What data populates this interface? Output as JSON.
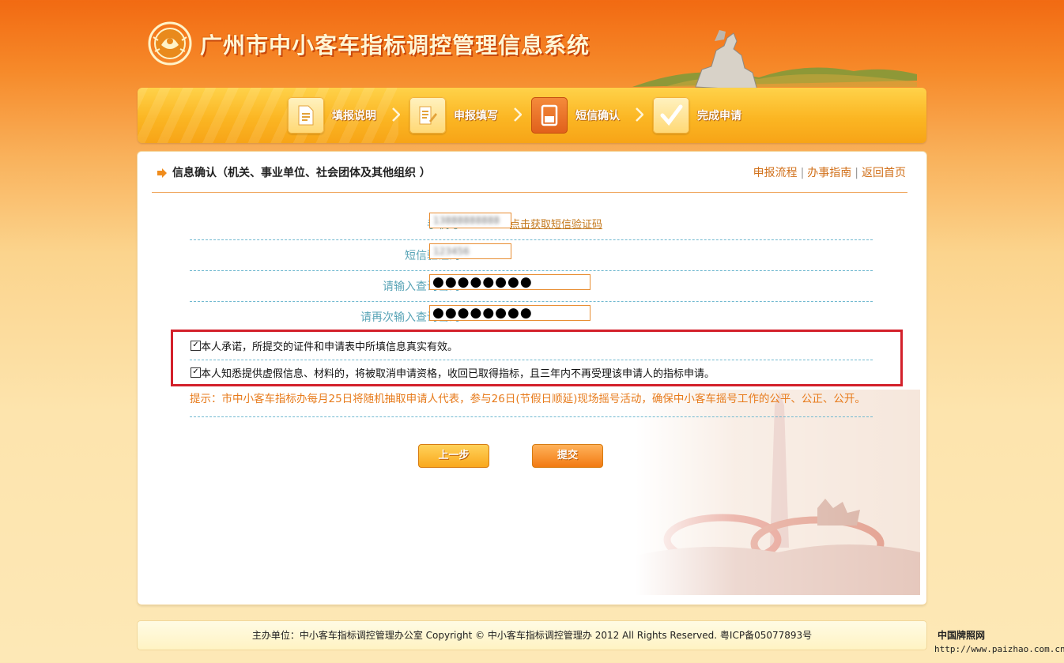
{
  "header": {
    "title": "广州市中小客车指标调控管理信息系统"
  },
  "steps": [
    {
      "label": "填报说明",
      "icon": "document-icon",
      "active": false
    },
    {
      "label": "申报填写",
      "icon": "edit-form-icon",
      "active": false
    },
    {
      "label": "短信确认",
      "icon": "phone-icon",
      "active": true
    },
    {
      "label": "完成申请",
      "icon": "checkmark-icon",
      "active": false
    }
  ],
  "card": {
    "title": "信息确认（机关、事业单位、社会团体及其他组织 ）",
    "links": [
      "申报流程",
      "办事指南",
      "返回首页"
    ]
  },
  "form": {
    "phone_label": "手机号：",
    "phone_value": "13888888888",
    "sms_link": "点击获取短信验证码",
    "code_label": "短信验证码：",
    "code_value": "123456",
    "password_label": "请输入查询密码：",
    "password_value": "●●●●●●●●",
    "password2_label": "请再次输入查询密码：",
    "password2_value": "●●●●●●●●"
  },
  "agreements": [
    {
      "checked": true,
      "text": "本人承诺，所提交的证件和申请表中所填信息真实有效。"
    },
    {
      "checked": true,
      "text": "本人知悉提供虚假信息、材料的，将被取消申请资格，收回已取得指标，且三年内不再受理该申请人的指标申请。"
    }
  ],
  "tip": "提示：市中小客车指标办每月25日将随机抽取申请人代表，参与26日(节假日顺延)现场摇号活动，确保中小客车摇号工作的公平、公正、公开。",
  "buttons": {
    "prev": "上一步",
    "submit": "提交"
  },
  "footer": {
    "text": "主办单位：中小客车指标调控管理办公室  Copyright  ©  中小客车指标调控管理办    2012  All Rights Reserved.  粤ICP备05077893号"
  },
  "watermark": {
    "name": "中国牌照网",
    "url": "http://www.paizhao.com.cn"
  },
  "colors": {
    "accent_orange": "#f26a12",
    "highlight_red": "#d3202a",
    "label_teal": "#5aa5b7",
    "tip_orange": "#e77b1c"
  }
}
